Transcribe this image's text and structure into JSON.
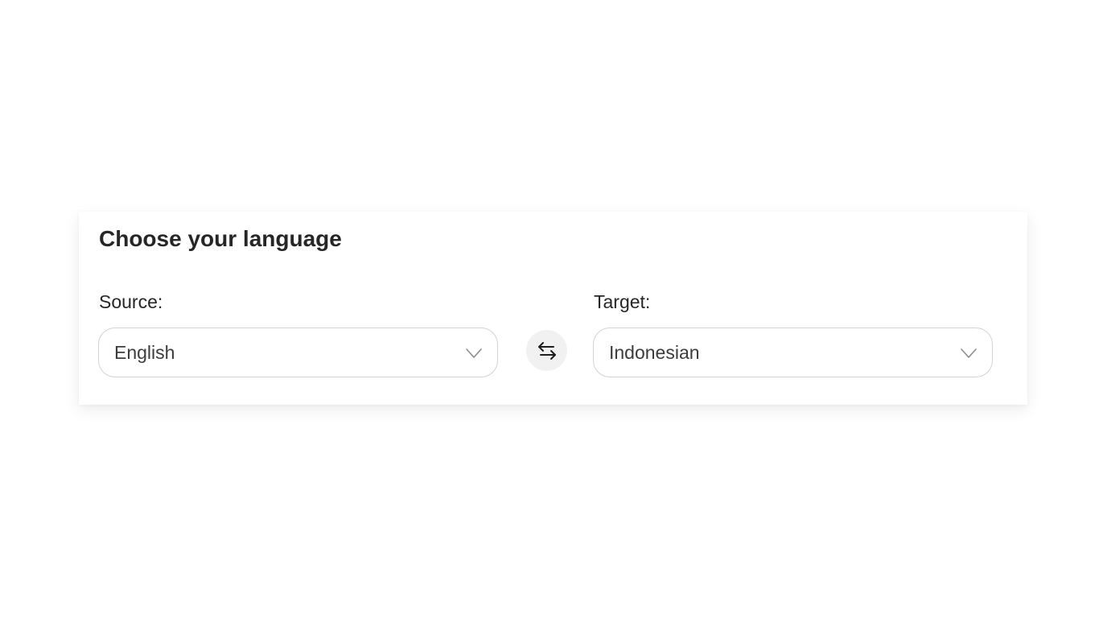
{
  "language_picker": {
    "title": "Choose your language",
    "source": {
      "label": "Source:",
      "value": "English"
    },
    "target": {
      "label": "Target:",
      "value": "Indonesian"
    },
    "icons": {
      "swap": "swap-arrows-icon",
      "dropdown": "chevron-down-icon"
    }
  }
}
